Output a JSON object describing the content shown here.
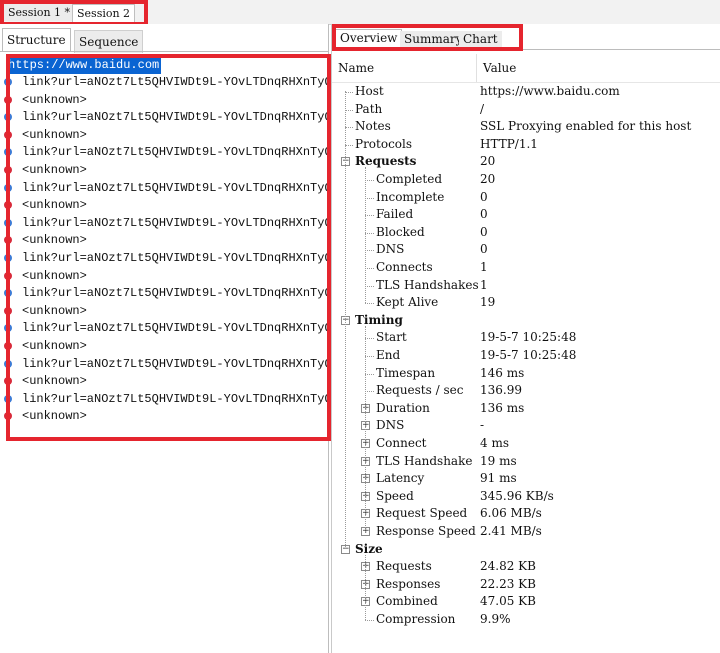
{
  "sessions": [
    {
      "label": "Session 1 *"
    },
    {
      "label": "Session 2"
    }
  ],
  "left_tabs": [
    "Structure",
    "Sequence"
  ],
  "tree": {
    "root": "https://www.baidu.com",
    "rows": [
      {
        "text": "link?url=aNOzt7Lt5QHVIWDt9L-YOvLTDnqRHXnTyQb0_",
        "icon": "blue"
      },
      {
        "text": "<unknown>",
        "icon": "red"
      },
      {
        "text": "link?url=aNOzt7Lt5QHVIWDt9L-YOvLTDnqRHXnTyQb0_",
        "icon": "blue"
      },
      {
        "text": "<unknown>",
        "icon": "red"
      },
      {
        "text": "link?url=aNOzt7Lt5QHVIWDt9L-YOvLTDnqRHXnTyQb0_",
        "icon": "blue"
      },
      {
        "text": "<unknown>",
        "icon": "red"
      },
      {
        "text": "link?url=aNOzt7Lt5QHVIWDt9L-YOvLTDnqRHXnTyQb0_",
        "icon": "blue"
      },
      {
        "text": "<unknown>",
        "icon": "red"
      },
      {
        "text": "link?url=aNOzt7Lt5QHVIWDt9L-YOvLTDnqRHXnTyQb0_",
        "icon": "blue"
      },
      {
        "text": "<unknown>",
        "icon": "red"
      },
      {
        "text": "link?url=aNOzt7Lt5QHVIWDt9L-YOvLTDnqRHXnTyQb0_",
        "icon": "blue"
      },
      {
        "text": "<unknown>",
        "icon": "red"
      },
      {
        "text": "link?url=aNOzt7Lt5QHVIWDt9L-YOvLTDnqRHXnTyQb0_",
        "icon": "blue"
      },
      {
        "text": "<unknown>",
        "icon": "red"
      },
      {
        "text": "link?url=aNOzt7Lt5QHVIWDt9L-YOvLTDnqRHXnTyQb0_",
        "icon": "blue"
      },
      {
        "text": "<unknown>",
        "icon": "red"
      },
      {
        "text": "link?url=aNOzt7Lt5QHVIWDt9L-YOvLTDnqRHXnTyQb0_",
        "icon": "blue"
      },
      {
        "text": "<unknown>",
        "icon": "red"
      },
      {
        "text": "link?url=aNOzt7Lt5QHVIWDt9L-YOvLTDnqRHXnTyQb0_",
        "icon": "blue"
      },
      {
        "text": "<unknown>",
        "icon": "red"
      }
    ]
  },
  "right_tabs": [
    "Overview",
    "Summary",
    "Chart"
  ],
  "table": {
    "header_name": "Name",
    "header_value": "Value",
    "rows": [
      {
        "label": "Host",
        "value": "https://www.baidu.com",
        "level": 0,
        "bold": false,
        "expander": "none"
      },
      {
        "label": "Path",
        "value": "/",
        "level": 0,
        "bold": false,
        "expander": "none"
      },
      {
        "label": "Notes",
        "value": "SSL Proxying enabled for this host",
        "level": 0,
        "bold": false,
        "expander": "none"
      },
      {
        "label": "Protocols",
        "value": "HTTP/1.1",
        "level": 0,
        "bold": false,
        "expander": "none"
      },
      {
        "label": "Requests",
        "value": "20",
        "level": 0,
        "bold": true,
        "expander": "minus"
      },
      {
        "label": "Completed",
        "value": "20",
        "level": 1,
        "bold": false,
        "expander": "none"
      },
      {
        "label": "Incomplete",
        "value": "0",
        "level": 1,
        "bold": false,
        "expander": "none"
      },
      {
        "label": "Failed",
        "value": "0",
        "level": 1,
        "bold": false,
        "expander": "none"
      },
      {
        "label": "Blocked",
        "value": "0",
        "level": 1,
        "bold": false,
        "expander": "none"
      },
      {
        "label": "DNS",
        "value": "0",
        "level": 1,
        "bold": false,
        "expander": "none"
      },
      {
        "label": "Connects",
        "value": "1",
        "level": 1,
        "bold": false,
        "expander": "none"
      },
      {
        "label": "TLS Handshakes",
        "value": "1",
        "level": 1,
        "bold": false,
        "expander": "none"
      },
      {
        "label": "Kept Alive",
        "value": "19",
        "level": 1,
        "bold": false,
        "expander": "none"
      },
      {
        "label": "Timing",
        "value": "",
        "level": 0,
        "bold": true,
        "expander": "minus"
      },
      {
        "label": "Start",
        "value": "19-5-7 10:25:48",
        "level": 1,
        "bold": false,
        "expander": "none"
      },
      {
        "label": "End",
        "value": "19-5-7 10:25:48",
        "level": 1,
        "bold": false,
        "expander": "none"
      },
      {
        "label": "Timespan",
        "value": "146 ms",
        "level": 1,
        "bold": false,
        "expander": "none"
      },
      {
        "label": "Requests / sec",
        "value": "136.99",
        "level": 1,
        "bold": false,
        "expander": "none"
      },
      {
        "label": "Duration",
        "value": "136 ms",
        "level": 1,
        "bold": false,
        "expander": "plus"
      },
      {
        "label": "DNS",
        "value": "-",
        "level": 1,
        "bold": false,
        "expander": "plus"
      },
      {
        "label": "Connect",
        "value": "4 ms",
        "level": 1,
        "bold": false,
        "expander": "plus"
      },
      {
        "label": "TLS Handshake",
        "value": "19 ms",
        "level": 1,
        "bold": false,
        "expander": "plus"
      },
      {
        "label": "Latency",
        "value": "91 ms",
        "level": 1,
        "bold": false,
        "expander": "plus"
      },
      {
        "label": "Speed",
        "value": "345.96 KB/s",
        "level": 1,
        "bold": false,
        "expander": "plus"
      },
      {
        "label": "Request Speed",
        "value": "6.06 MB/s",
        "level": 1,
        "bold": false,
        "expander": "plus"
      },
      {
        "label": "Response Speed",
        "value": "2.41 MB/s",
        "level": 1,
        "bold": false,
        "expander": "plus"
      },
      {
        "label": "Size",
        "value": "",
        "level": 0,
        "bold": true,
        "expander": "minus"
      },
      {
        "label": "Requests",
        "value": "24.82 KB",
        "level": 1,
        "bold": false,
        "expander": "plus"
      },
      {
        "label": "Responses",
        "value": "22.23 KB",
        "level": 1,
        "bold": false,
        "expander": "plus"
      },
      {
        "label": "Combined",
        "value": "47.05 KB",
        "level": 1,
        "bold": false,
        "expander": "plus"
      },
      {
        "label": "Compression",
        "value": "9.9%",
        "level": 1,
        "bold": false,
        "expander": "none"
      }
    ]
  },
  "colors": {
    "highlight_box": "#e5252e",
    "selection": "#0a64d2",
    "icon_request": "#3b7bd6",
    "icon_unknown": "#d82a3a"
  }
}
